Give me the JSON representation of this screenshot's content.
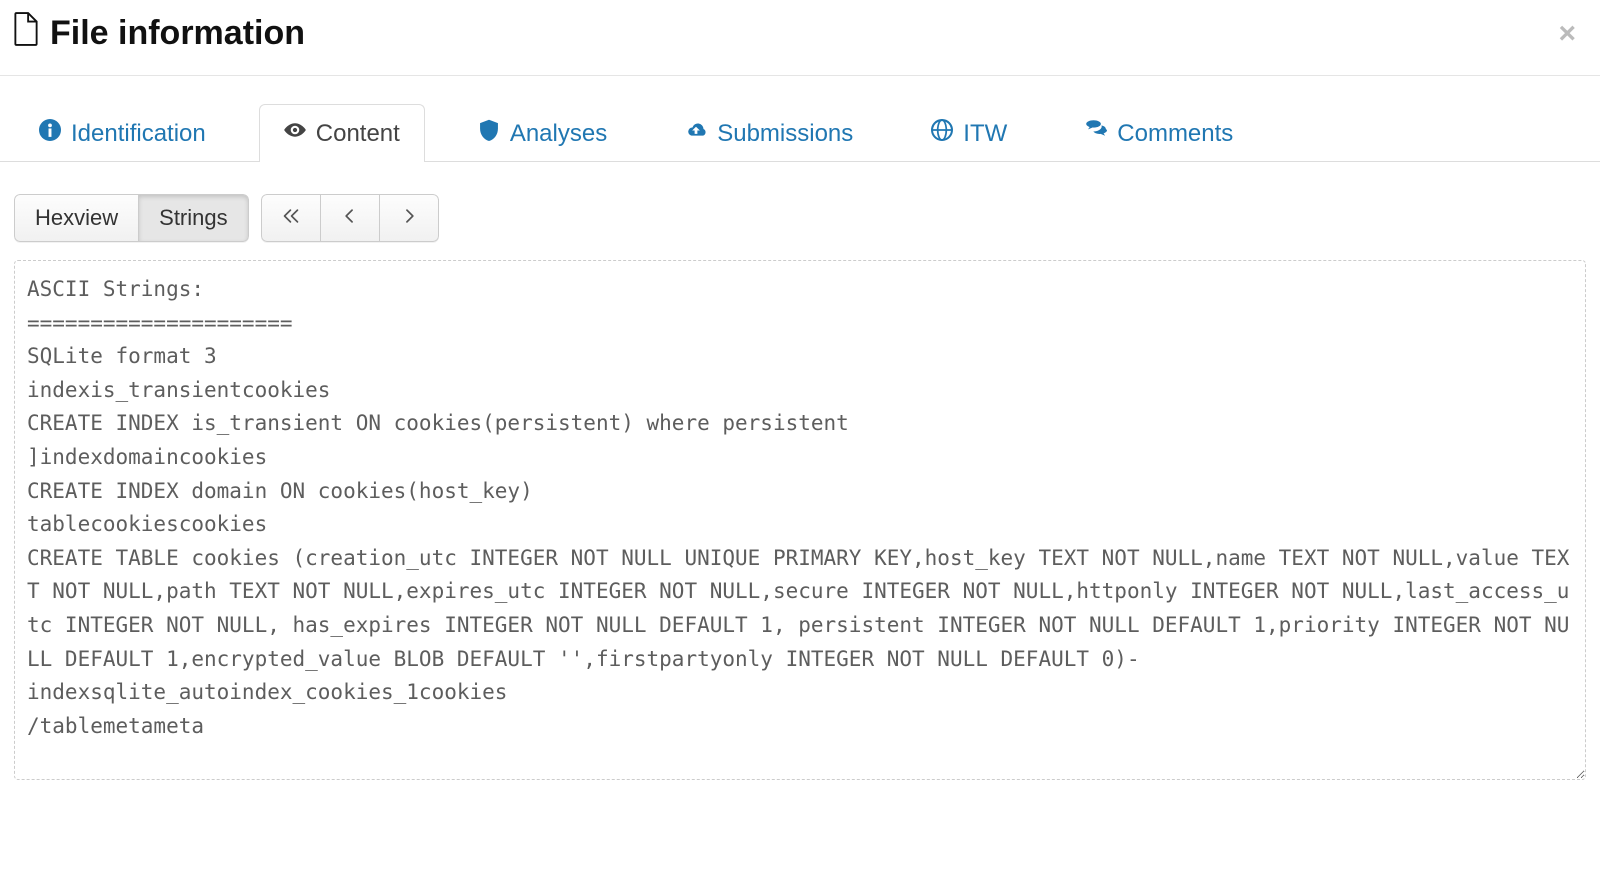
{
  "header": {
    "title": "File information"
  },
  "tabs": {
    "identification": "Identification",
    "content": "Content",
    "analyses": "Analyses",
    "submissions": "Submissions",
    "itw": "ITW",
    "comments": "Comments"
  },
  "toolbar": {
    "hexview_label": "Hexview",
    "strings_label": "Strings"
  },
  "content": {
    "strings_output": "ASCII Strings:\n=====================\nSQLite format 3\nindexis_transientcookies\nCREATE INDEX is_transient ON cookies(persistent) where persistent\n]indexdomaincookies\nCREATE INDEX domain ON cookies(host_key)\ntablecookiescookies\nCREATE TABLE cookies (creation_utc INTEGER NOT NULL UNIQUE PRIMARY KEY,host_key TEXT NOT NULL,name TEXT NOT NULL,value TEXT NOT NULL,path TEXT NOT NULL,expires_utc INTEGER NOT NULL,secure INTEGER NOT NULL,httponly INTEGER NOT NULL,last_access_utc INTEGER NOT NULL, has_expires INTEGER NOT NULL DEFAULT 1, persistent INTEGER NOT NULL DEFAULT 1,priority INTEGER NOT NULL DEFAULT 1,encrypted_value BLOB DEFAULT '',firstpartyonly INTEGER NOT NULL DEFAULT 0)-\nindexsqlite_autoindex_cookies_1cookies\n/tablemetameta"
  }
}
